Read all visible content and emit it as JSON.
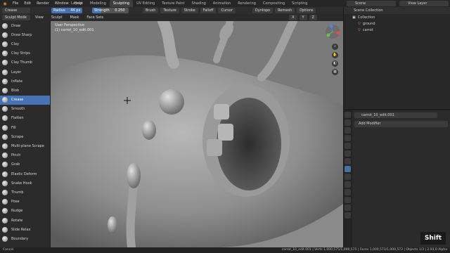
{
  "menu": [
    "File",
    "Edit",
    "Render",
    "Window",
    "Help"
  ],
  "workspaces": [
    "Layout",
    "Modeling",
    "Sculpting",
    "UV Editing",
    "Texture Paint",
    "Shading",
    "Animation",
    "Rendering",
    "Compositing",
    "Scripting"
  ],
  "active_workspace": "Sculpting",
  "scene": "Scene",
  "view_layer": "View Layer",
  "toolbar": {
    "brush": "Crease",
    "radius_label": "Radius",
    "radius_value": "44 px",
    "strength_label": "Strength",
    "strength_value": "0.250",
    "strength_fraction": 0.25,
    "brush_menu": "Brush",
    "texture_menu": "Texture",
    "stroke_menu": "Stroke",
    "falloff_menu": "Falloff",
    "cursor_menu": "Cursor",
    "dyntopo": "Dyntopo",
    "remesh": "Remesh",
    "options": "Options"
  },
  "header2": {
    "mode": "Sculpt Mode",
    "view": "View",
    "sculpt": "Sculpt",
    "mask": "Mask",
    "face_sets": "Face Sets",
    "x": "X",
    "y": "Y",
    "z": "Z"
  },
  "tools": [
    "Draw",
    "Draw Sharp",
    "Clay",
    "Clay Strips",
    "Clay Thumb",
    "Layer",
    "Inflate",
    "Blob",
    "Crease",
    "Smooth",
    "Flatten",
    "Fill",
    "Scrape",
    "Multi-plane Scrape",
    "Pinch",
    "Grab",
    "Elastic Deform",
    "Snake Hook",
    "Thumb",
    "Pose",
    "Nudge",
    "Rotate",
    "Slide Relax",
    "Boundary"
  ],
  "active_tool": "Crease",
  "viewport": {
    "view_name": "User Perspective",
    "object_label": "(1) carrot_10_edit.001",
    "gizmo_labels": [
      "X",
      "Y",
      "Z"
    ]
  },
  "outliner": {
    "title": "Scene Collection",
    "items": [
      {
        "label": "Collection",
        "depth": 1
      },
      {
        "label": "ground",
        "depth": 2
      },
      {
        "label": "carrot",
        "depth": 2
      }
    ]
  },
  "properties": {
    "object_name": "carrot_10_edit.001",
    "add_modifier": "Add Modifier"
  },
  "status": {
    "left": "Cancel",
    "right": "carrot_10_edit.001 | Verts 1,000,575/1,000,575 | Faces 1,000,573/1,000,573 | Objects 1/3 | 2.93.0 Alpha"
  },
  "key_overlay": "Shift"
}
